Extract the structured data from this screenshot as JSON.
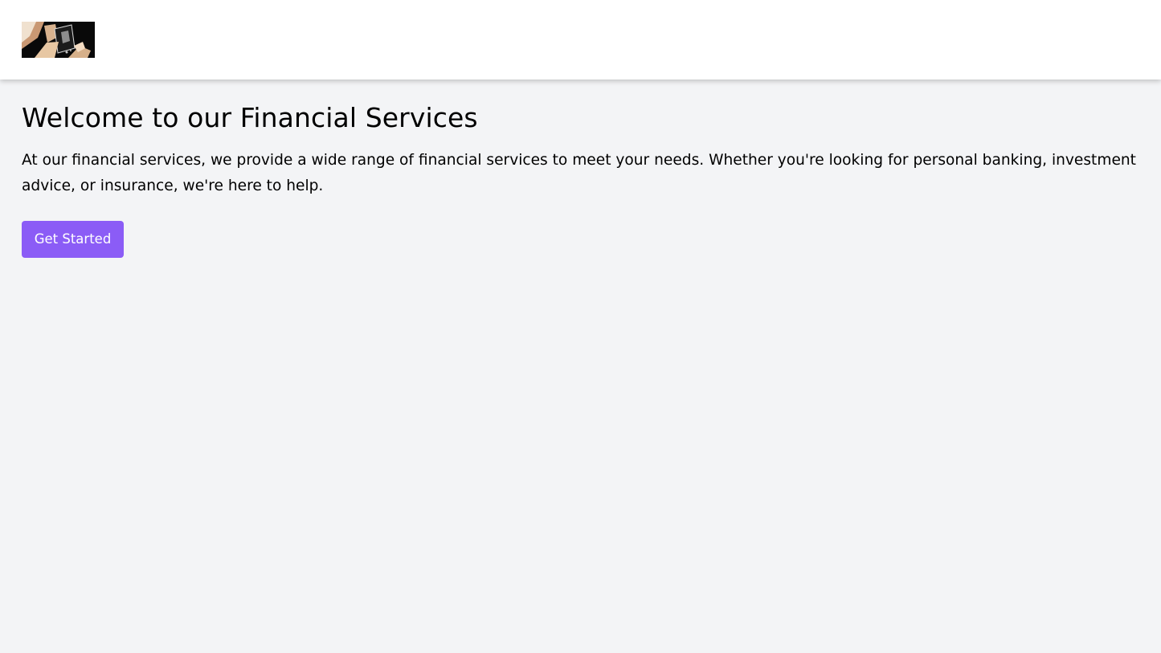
{
  "header": {
    "logo_image": "hands-holding-smartphone-photo"
  },
  "main": {
    "title": "Welcome to our Financial Services",
    "intro": "At our financial services, we provide a wide range of financial services to meet your needs. Whether you're looking for personal banking, investment advice, or insurance, we're here to help.",
    "cta_label": "Get Started"
  },
  "colors": {
    "page_background": "#f3f4f6",
    "header_background": "#ffffff",
    "button_accent": "#8b5cf6",
    "button_text": "#ffffff",
    "text": "#000000"
  }
}
